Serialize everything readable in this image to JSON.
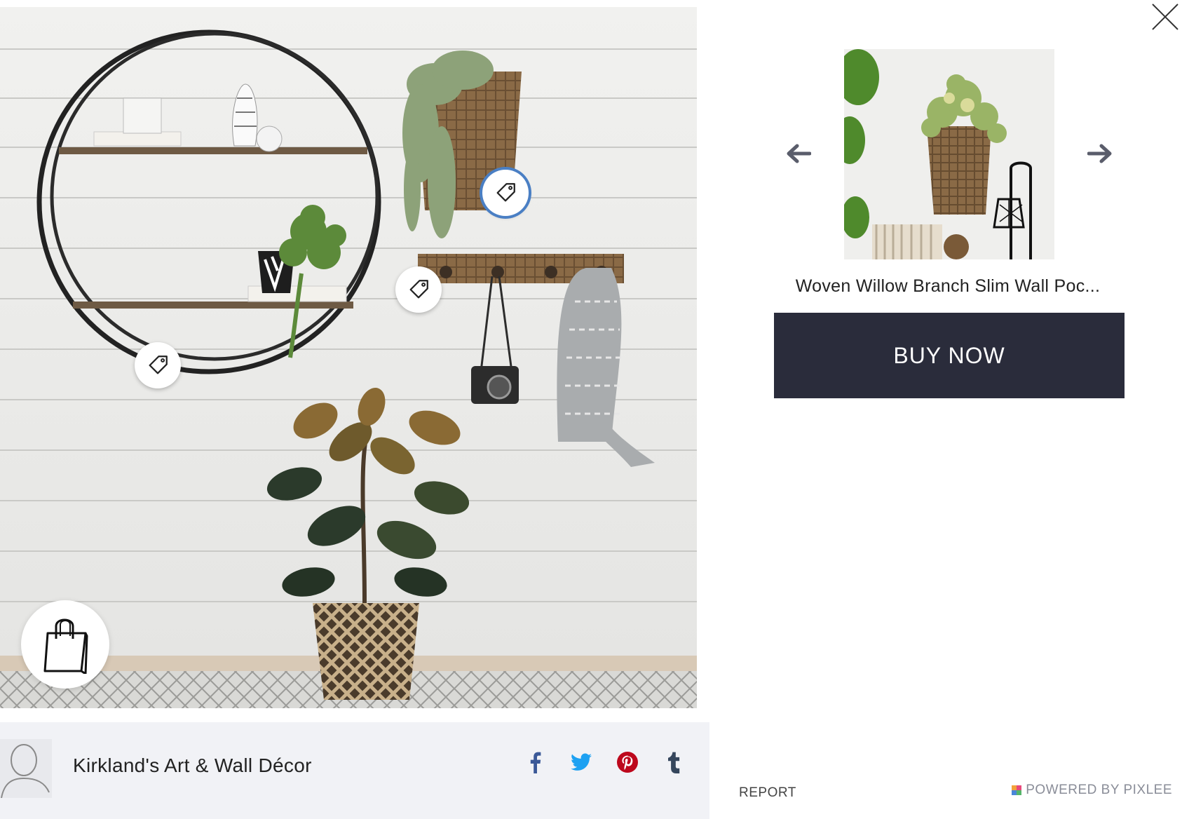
{
  "photo": {
    "hotspots": [
      {
        "name": "product-tag-basket",
        "active": true
      },
      {
        "name": "product-tag-hook-rack",
        "active": false
      },
      {
        "name": "product-tag-round-shelf",
        "active": false
      }
    ]
  },
  "source": {
    "name": "Kirkland's Art & Wall Décor"
  },
  "socials": [
    {
      "icon": "facebook-icon",
      "color": "#3b5998"
    },
    {
      "icon": "twitter-icon",
      "color": "#1da1f2"
    },
    {
      "icon": "pinterest-icon",
      "color": "#bd081c"
    },
    {
      "icon": "tumblr-icon",
      "color": "#35465c"
    }
  ],
  "product": {
    "title": "Woven Willow Branch Slim Wall Poc...",
    "buy_label": "BUY NOW",
    "button_color": "#2a2c3b"
  },
  "footer": {
    "report_label": "REPORT",
    "powered_label": "POWERED BY PIXLEE"
  }
}
